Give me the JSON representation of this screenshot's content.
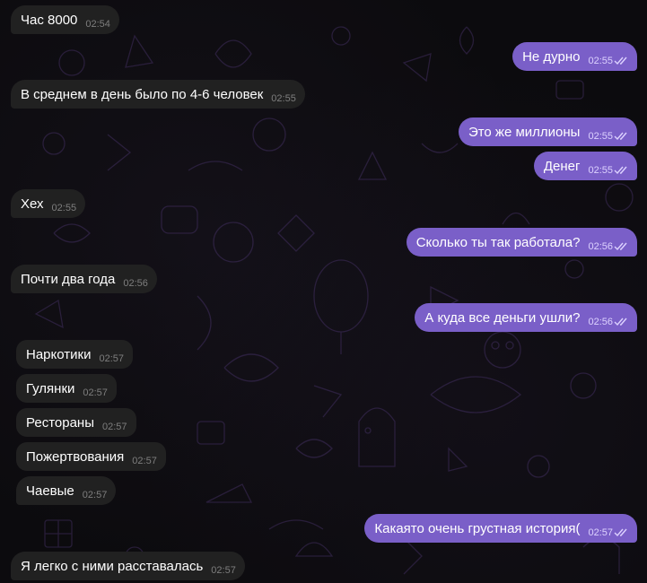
{
  "colors": {
    "background": "#0c0b0e",
    "incoming_bubble": "#212121",
    "outgoing_bubble": "#7a5fc8",
    "incoming_time": "#7e7e7e",
    "outgoing_time": "#ddd2ff"
  },
  "messages": [
    {
      "direction": "in",
      "text": "Час 8000",
      "time": "02:54"
    },
    {
      "direction": "out",
      "text": "Не дурно",
      "time": "02:55",
      "status": "read-double-check-icon"
    },
    {
      "direction": "in",
      "text": "В среднем в день было по 4-6 человек",
      "time": "02:55"
    },
    {
      "direction": "out",
      "text": "Это же миллионы",
      "time": "02:55",
      "status": "read-double-check-icon"
    },
    {
      "direction": "out",
      "text": "Денег",
      "time": "02:55",
      "status": "read-double-check-icon"
    },
    {
      "direction": "in",
      "text": "Хех",
      "time": "02:55"
    },
    {
      "direction": "out",
      "text": "Сколько ты так работала?",
      "time": "02:56",
      "status": "read-double-check-icon"
    },
    {
      "direction": "in",
      "text": "Почти два года",
      "time": "02:56"
    },
    {
      "direction": "out",
      "text": "А куда все деньги ушли?",
      "time": "02:56",
      "status": "read-double-check-icon"
    },
    {
      "direction": "in",
      "text": "Наркотики",
      "time": "02:57"
    },
    {
      "direction": "in",
      "text": "Гулянки",
      "time": "02:57"
    },
    {
      "direction": "in",
      "text": "Рестораны",
      "time": "02:57"
    },
    {
      "direction": "in",
      "text": "Пожертвования",
      "time": "02:57"
    },
    {
      "direction": "in",
      "text": "Чаевые",
      "time": "02:57"
    },
    {
      "direction": "out",
      "text": "Какаято очень грустная история(",
      "time": "02:57",
      "status": "read-double-check-icon"
    },
    {
      "direction": "in",
      "text": "Я легко с ними расставалась",
      "time": "02:57"
    }
  ]
}
